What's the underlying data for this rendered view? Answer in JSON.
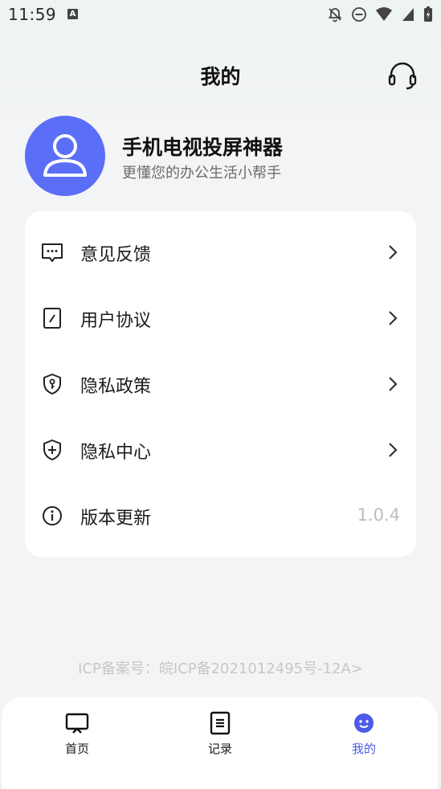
{
  "status_bar": {
    "time": "11:59",
    "notification_icon_letter": "A"
  },
  "header": {
    "title": "我的",
    "support_icon": "headset-icon"
  },
  "profile": {
    "app_name": "手机电视投屏神器",
    "slogan": "更懂您的办公生活小帮手",
    "avatar_color": "#5a6ef8"
  },
  "menu": {
    "items": [
      {
        "label": "意见反馈",
        "icon": "feedback-icon"
      },
      {
        "label": "用户协议",
        "icon": "agreement-icon"
      },
      {
        "label": "隐私政策",
        "icon": "privacy-policy-icon"
      },
      {
        "label": "隐私中心",
        "icon": "privacy-center-icon"
      },
      {
        "label": "版本更新",
        "icon": "info-icon",
        "value": "1.0.4"
      }
    ]
  },
  "footer": {
    "icp": "ICP备案号：皖ICP备2021012495号-12A>"
  },
  "bottom_nav": {
    "items": [
      {
        "label": "首页",
        "icon": "tv-icon"
      },
      {
        "label": "记录",
        "icon": "record-icon"
      },
      {
        "label": "我的",
        "icon": "smiley-icon",
        "active": true
      }
    ],
    "active_color": "#4b5ae8"
  }
}
